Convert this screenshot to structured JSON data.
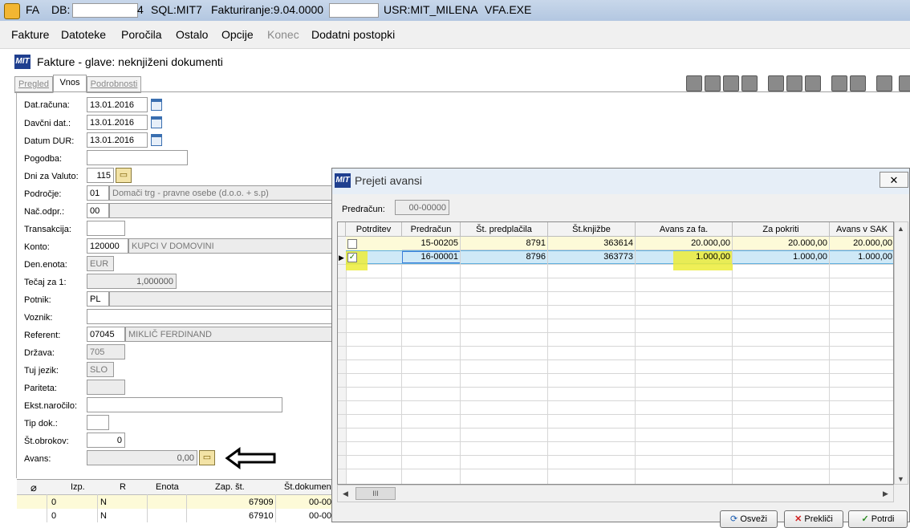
{
  "titlebar": {
    "app": "FA",
    "db_label": "DB:",
    "db_tail": "4",
    "sql": "SQL:MIT7",
    "version": "Fakturiranje:9.04.0000",
    "user": "USR:MIT_MILENA",
    "exe": "VFA.EXE"
  },
  "menu": [
    "Fakture",
    "Datoteke",
    "Poročila",
    "Ostalo",
    "Opcije",
    "Konec",
    "Dodatni postopki"
  ],
  "window": {
    "logo": "MIT",
    "title": "Fakture - glave: neknjiženi dokumenti",
    "tabs": [
      "Pregled",
      "Vnos",
      "Podrobnosti"
    ]
  },
  "form": {
    "dat_racuna": {
      "label": "Dat.računa:",
      "value": "13.01.2016"
    },
    "davcni_dat": {
      "label": "Davčni dat.:",
      "value": "13.01.2016"
    },
    "datum_dur": {
      "label": "Datum DUR:",
      "value": "13.01.2016"
    },
    "pogodba": {
      "label": "Pogodba:",
      "value": ""
    },
    "dni_za_valuto": {
      "label": "Dni za Valuto:",
      "value": "115"
    },
    "podrocje": {
      "label": "Področje:",
      "code": "01",
      "desc": "Domači trg - pravne osebe (d.o.o. + s.p)"
    },
    "nac_odpr": {
      "label": "Nač.odpr.:",
      "code": "00"
    },
    "transakcija": {
      "label": "Transakcija:"
    },
    "konto": {
      "label": "Konto:",
      "code": "120000",
      "desc": "KUPCI V DOMOVINI"
    },
    "den_enota": {
      "label": "Den.enota:",
      "value": "EUR"
    },
    "tecaj": {
      "label": "Tečaj za 1:",
      "value": "1,000000"
    },
    "potnik": {
      "label": "Potnik:",
      "code": "PL"
    },
    "voznik": {
      "label": "Voznik:"
    },
    "referent": {
      "label": "Referent:",
      "code": "07045",
      "desc": "MIKLIČ FERDINAND"
    },
    "drzava": {
      "label": "Država:",
      "value": "705"
    },
    "tuj_jezik": {
      "label": "Tuj jezik:",
      "value": "SLO"
    },
    "pariteta": {
      "label": "Pariteta:"
    },
    "ekst_narocilo": {
      "label": "Ekst.naročilo:"
    },
    "tip_dok": {
      "label": "Tip dok.:"
    },
    "st_obrokov": {
      "label": "Št.obrokov:",
      "value": "0"
    },
    "avans": {
      "label": "Avans:",
      "value": "0,00"
    }
  },
  "bottom_grid": {
    "headers": [
      "Izp.",
      "R",
      "Enota",
      "Zap. št.",
      "Št.dokumen"
    ],
    "rows": [
      {
        "izp": "0",
        "r": "N",
        "enota": "",
        "zap": "67909",
        "st": "00-00"
      },
      {
        "izp": "0",
        "r": "N",
        "enota": "",
        "zap": "67910",
        "st": "00-00"
      }
    ]
  },
  "dialog": {
    "logo": "MIT",
    "title": "Prejeti avansi",
    "close": "✕",
    "predracun_label": "Predračun:",
    "predracun_value": "00-00000",
    "headers": [
      "Potrditev",
      "Predračun",
      "Št. predplačila",
      "Št.knjižbe",
      "Avans za fa.",
      "Za pokriti",
      "Avans v SAK"
    ],
    "rows": [
      {
        "potrditev": false,
        "predracun": "15-00205",
        "st_predplacila": "8791",
        "st_knjizbe": "363614",
        "avans_za_fa": "20.000,00",
        "za_pokriti": "20.000,00",
        "avans_v_sak": "20.000,00"
      },
      {
        "potrditev": true,
        "predracun": "16-00001",
        "st_predplacila": "8796",
        "st_knjizbe": "363773",
        "avans_za_fa": "1.000,00",
        "za_pokriti": "1.000,00",
        "avans_v_sak": "1.000,00"
      }
    ],
    "scroll_thumb": "III",
    "buttons": {
      "osvezi": "Osveži",
      "preklici": "Prekliči",
      "potrdi": "Potrdi"
    }
  },
  "colors": {
    "highlight": "#ecec6a",
    "selected_row": "#cfe9f7",
    "logo": "#1f3f8f",
    "first_row": "#fdfad8"
  }
}
